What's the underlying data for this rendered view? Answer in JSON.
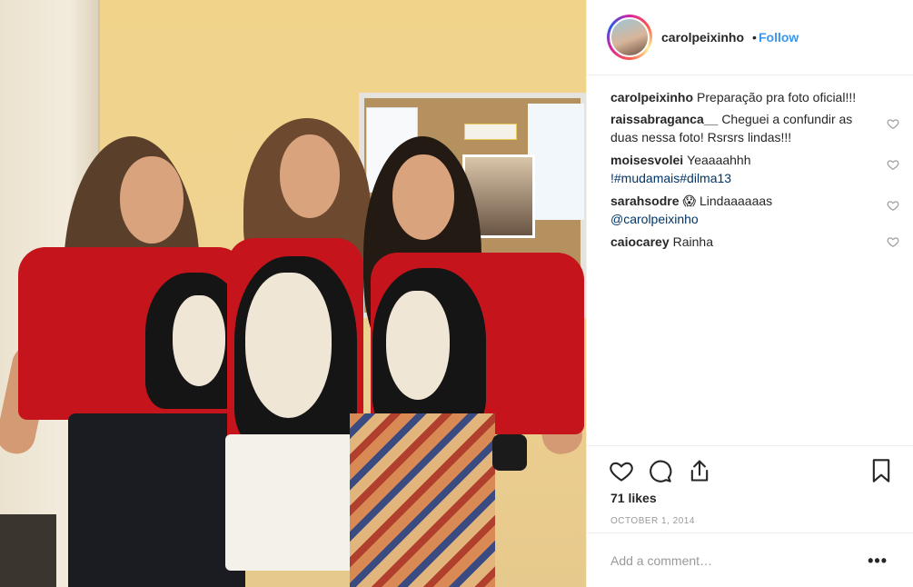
{
  "post": {
    "image_alt": "Três mulheres com camisetas vermelhas",
    "header": {
      "username": "carolpeixinho",
      "separator": "•",
      "follow_label": "Follow"
    },
    "caption": {
      "username": "carolpeixinho",
      "text": "Preparação pra foto oficial!!!"
    },
    "comments": [
      {
        "username": "raissabraganca__",
        "text": "Cheguei a confundir as duas nessa foto! Rsrsrs lindas!!!",
        "link": ""
      },
      {
        "username": "moisesvolei",
        "text": "Yeaaaahhh",
        "link": "!#mudamais#dilma13"
      },
      {
        "username": "sarahsodre",
        "text": "😱 Lindaaaaaas",
        "link": "@carolpeixinho"
      },
      {
        "username": "caiocarey",
        "text": "Rainha",
        "link": ""
      }
    ],
    "likes": "71 likes",
    "date": "OCTOBER 1, 2014",
    "add_comment_placeholder": "Add a comment…",
    "more_label": "•••",
    "icons": [
      "heart-icon",
      "comment-icon",
      "share-icon",
      "bookmark-icon"
    ],
    "colors": {
      "follow": "#3897f0",
      "link": "#003569",
      "muted": "#999999",
      "shirt": "#c6141d"
    }
  }
}
